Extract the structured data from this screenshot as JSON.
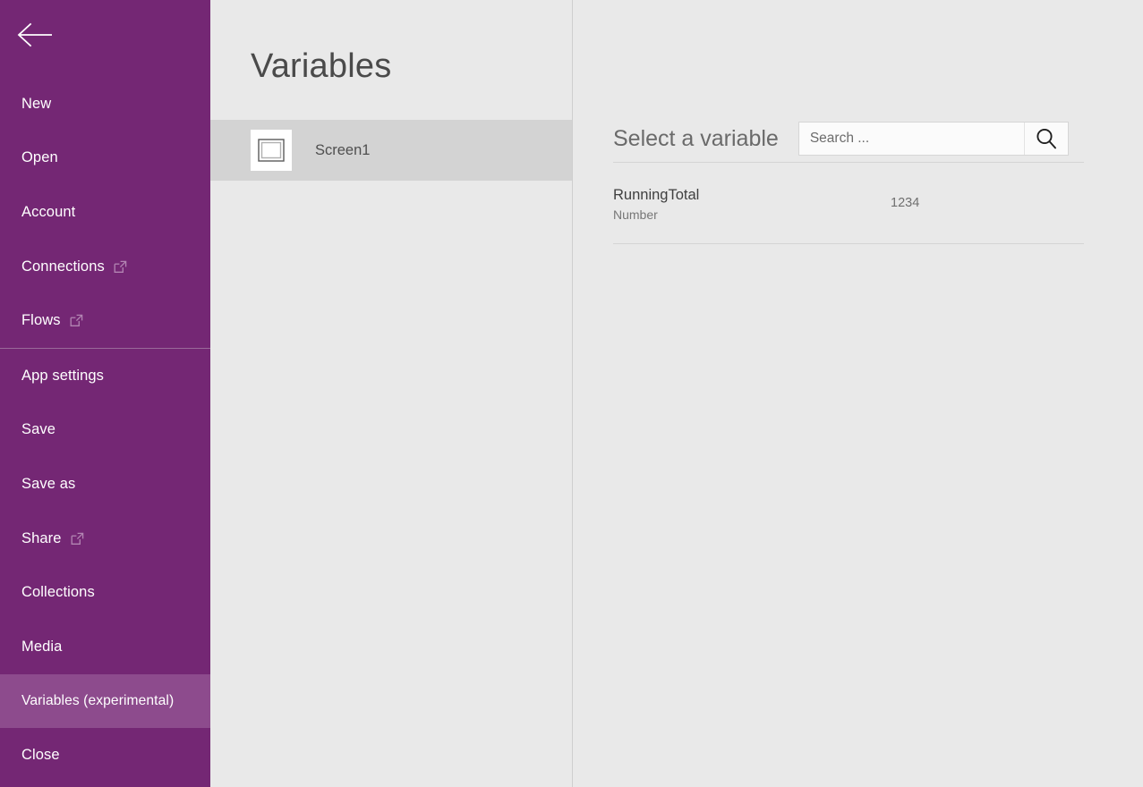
{
  "sidebar": {
    "background_color": "#742774",
    "highlight_color": "#8d4b8d",
    "back_button": {
      "name": "back-arrow-icon",
      "label": "Back"
    },
    "items": [
      {
        "label": "New",
        "external": false,
        "selected": false
      },
      {
        "label": "Open",
        "external": false,
        "selected": false
      },
      {
        "label": "Account",
        "external": false,
        "selected": false
      },
      {
        "label": "Connections",
        "external": true,
        "selected": false
      },
      {
        "label": "Flows",
        "external": true,
        "selected": false
      },
      {
        "label": "App settings",
        "external": false,
        "selected": false
      },
      {
        "label": "Save",
        "external": false,
        "selected": false
      },
      {
        "label": "Save as",
        "external": false,
        "selected": false
      },
      {
        "label": "Share",
        "external": true,
        "selected": false
      },
      {
        "label": "Collections",
        "external": false,
        "selected": false
      },
      {
        "label": "Media",
        "external": false,
        "selected": false
      },
      {
        "label": "Variables (experimental)",
        "external": false,
        "selected": true
      },
      {
        "label": "Close",
        "external": false,
        "selected": false
      }
    ]
  },
  "mid_panel": {
    "title": "Variables",
    "screens": [
      {
        "label": "Screen1",
        "icon": "screen-icon",
        "selected": true
      }
    ]
  },
  "right_panel": {
    "header_label": "Select a variable",
    "search": {
      "placeholder": "Search ...",
      "value": "",
      "icon": "search-icon"
    },
    "variables": [
      {
        "name": "RunningTotal",
        "type": "Number",
        "value": "1234"
      }
    ]
  }
}
